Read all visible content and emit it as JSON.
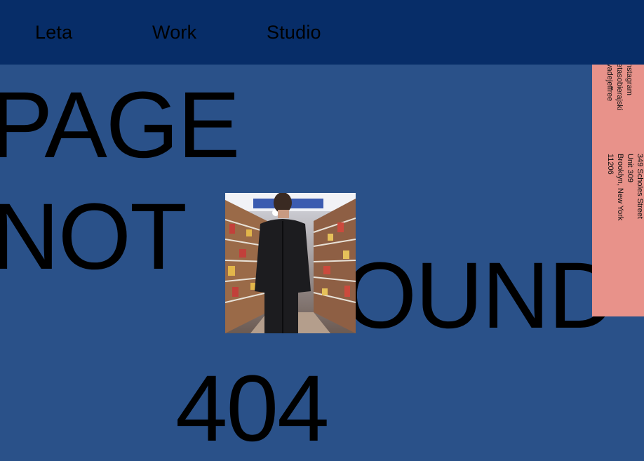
{
  "nav": {
    "items": [
      "Leta",
      "Work",
      "Studio"
    ]
  },
  "headline": {
    "line1": "PAGE",
    "line2": "NOT",
    "line3": "FOUND",
    "code": "404"
  },
  "contact": {
    "social": [
      "nstagram",
      "etasobierajski",
      "vadejeffree"
    ],
    "address": [
      "349 Scholes Street",
      "Unit 309",
      "Brooklyn, New York",
      "11206"
    ]
  },
  "colors": {
    "background": "#2a5189",
    "topbar": "#072d68",
    "panel": "#e8928a"
  }
}
